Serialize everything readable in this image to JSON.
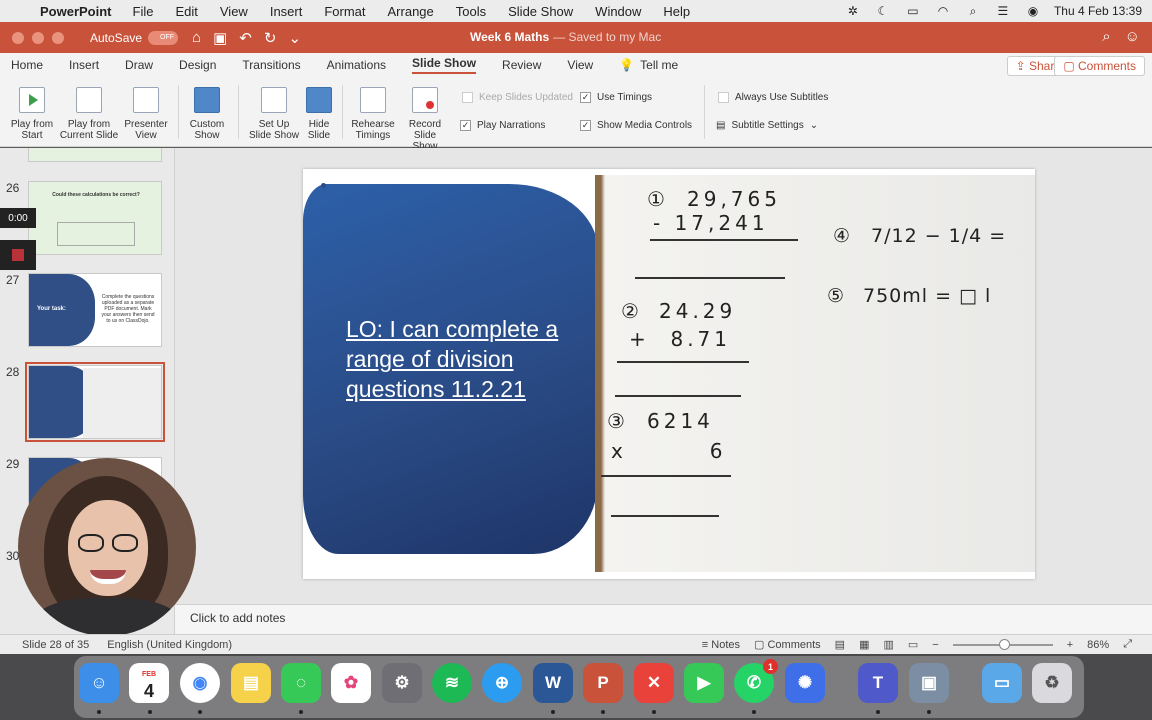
{
  "menubar": {
    "app_name": "PowerPoint",
    "items": [
      "File",
      "Edit",
      "View",
      "Insert",
      "Format",
      "Arrange",
      "Tools",
      "Slide Show",
      "Window",
      "Help"
    ],
    "datetime": "Thu 4 Feb  13:39"
  },
  "titlebar": {
    "autosave_label": "AutoSave",
    "autosave_state": "OFF",
    "doc_title": "Week 6 Maths",
    "saved_status": "— Saved to my Mac"
  },
  "ribbon_tabs": {
    "tabs": [
      "Home",
      "Insert",
      "Draw",
      "Design",
      "Transitions",
      "Animations",
      "Slide Show",
      "Review",
      "View"
    ],
    "active": "Slide Show",
    "tell_me": "Tell me",
    "share": "Share",
    "comments": "Comments"
  },
  "ribbon": {
    "play_from_start": "Play from\nStart",
    "play_from_current": "Play from\nCurrent Slide",
    "presenter_view": "Presenter\nView",
    "custom_show": "Custom\nShow",
    "setup_show": "Set Up\nSlide Show",
    "hide_slide": "Hide\nSlide",
    "rehearse": "Rehearse\nTimings",
    "record": "Record\nSlide Show",
    "keep_slides_updated": "Keep Slides Updated",
    "use_timings": "Use Timings",
    "play_narrations": "Play Narrations",
    "show_media_controls": "Show Media Controls",
    "always_use_subtitles": "Always Use Subtitles",
    "subtitle_settings": "Subtitle Settings"
  },
  "thumbnails": {
    "numbers": [
      "26",
      "27",
      "28",
      "29",
      "30"
    ],
    "t26_title": "Could these calculations be correct?",
    "t27_left": "Your task:",
    "t27_right": "Complete the questions uploaded as a separate PDF document. Mark your answers then send to us on ClassDojo."
  },
  "recording": {
    "time": "0:00"
  },
  "slide": {
    "title": "LO: I can complete a range of division questions 11.2.21",
    "q1_label": "①",
    "q1_a": "29,765",
    "q1_b": "- 17,241",
    "q2_label": "②",
    "q2_a": "24.29",
    "q2_b": "+  8.71",
    "q3_label": "③",
    "q3_a": "6214",
    "q3_b": "x        6",
    "q4_label": "④",
    "q4_expr": "7/12 − 1/4 =",
    "q5_label": "⑤",
    "q5_expr": "750ml = □ l"
  },
  "notes": {
    "placeholder": "Click to add notes"
  },
  "statusbar": {
    "slide_info": "Slide 28 of 35",
    "language": "English (United Kingdom)",
    "notes_btn": "Notes",
    "comments_btn": "Comments",
    "zoom": "86%"
  },
  "dock": {
    "calendar_month": "FEB",
    "calendar_day": "4",
    "whatsapp_badge": "1"
  },
  "colors": {
    "accent": "#c9523a",
    "slide_blue": "#2a4b86"
  }
}
